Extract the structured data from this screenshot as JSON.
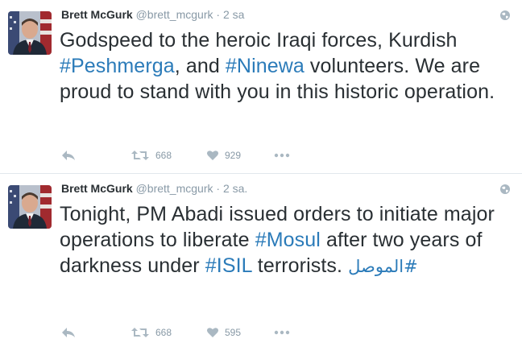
{
  "tweets": [
    {
      "author": {
        "name": "Brett McGurk",
        "handle": "@brett_mcgurk"
      },
      "separator": "·",
      "time": "2 sa",
      "text": {
        "p1": "Godspeed to the heroic Iraqi forces, Kurdish ",
        "h1": "#Peshmerga",
        "p2": ", and ",
        "h2": "#Ninewa",
        "p3": " volunteers. We are proud to stand with you in this historic operation."
      },
      "retweets": "668",
      "likes": "929"
    },
    {
      "author": {
        "name": "Brett McGurk",
        "handle": "@brett_mcgurk"
      },
      "separator": "·",
      "time": "2 sa.",
      "text": {
        "p1": "Tonight, PM Abadi issued orders to initiate major operations to liberate ",
        "h1": "#Mosul",
        "p2": " after two years of darkness under ",
        "h2": "#ISIL",
        "p3": " terrorists. ",
        "h3": "#الموصل"
      },
      "retweets": "668",
      "likes": "595"
    }
  ],
  "icons": {
    "reply": "reply-icon",
    "retweet": "retweet-icon",
    "like": "heart-icon",
    "more": "more-icon",
    "globe": "globe-icon"
  },
  "colors": {
    "hashtag": "#2b7bb9",
    "text": "#292f33",
    "muted": "#8899a6",
    "action": "#aab8c2",
    "divider": "#e1e8ed"
  }
}
